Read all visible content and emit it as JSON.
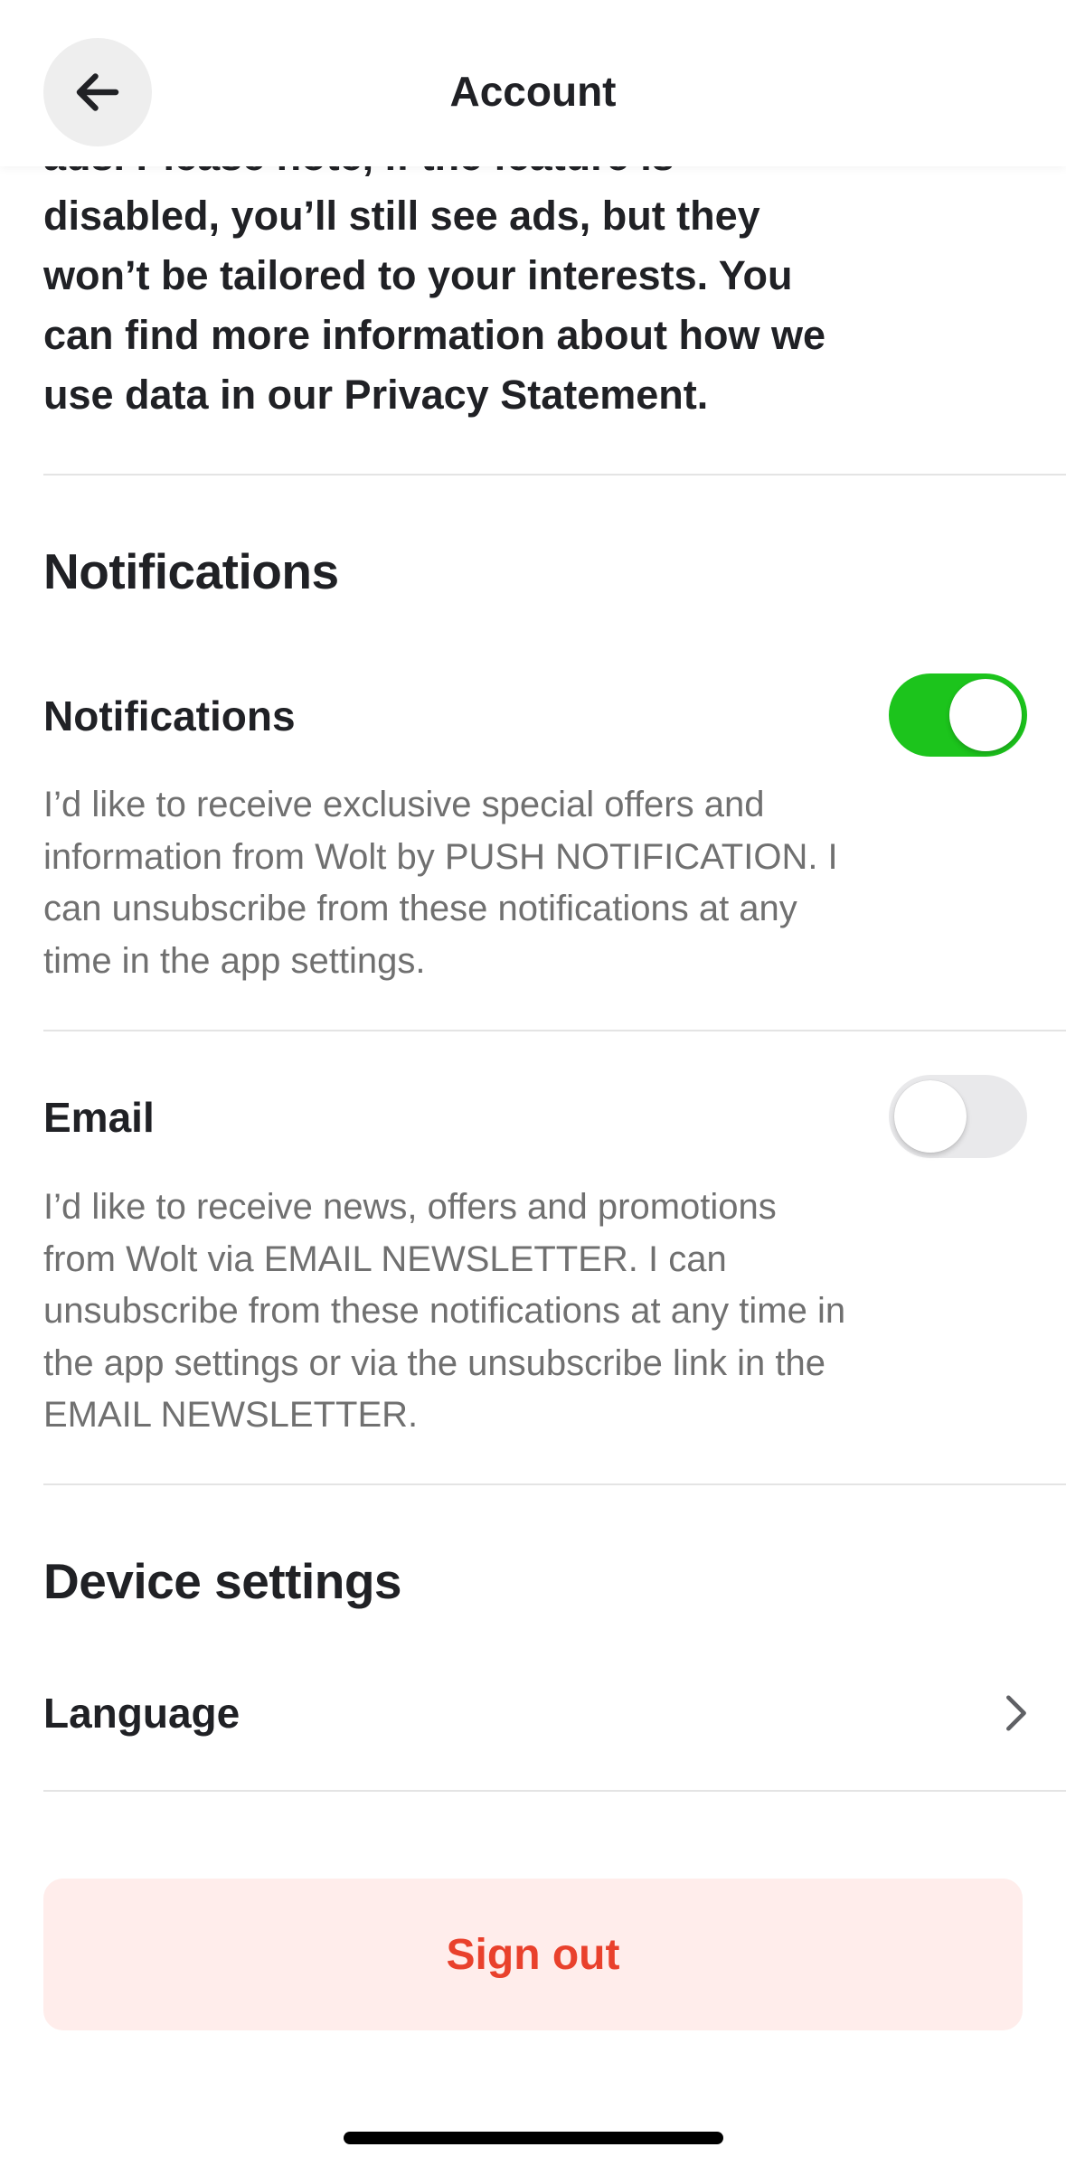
{
  "header": {
    "title": "Account",
    "back_icon": "arrow-left-icon"
  },
  "privacy": {
    "text": "ads. Please note, if the feature is disabled, you’ll still see ads, but they won’t be tailored to your interests. You can find more information about how we use data in our Privacy Statement."
  },
  "notifications_section": {
    "title": "Notifications",
    "push": {
      "title": "Notifications",
      "description": "I’d like to receive exclusive special offers and information from Wolt by PUSH NOTIFICATION. I can unsubscribe from these notifications at any time in the app settings.",
      "enabled": true
    },
    "email": {
      "title": "Email",
      "description": "I’d like to receive news, offers and promotions from Wolt via EMAIL NEWSLETTER. I can unsubscribe from these notifications at any time in the app settings or via the unsubscribe link in the EMAIL NEWSLETTER.",
      "enabled": false
    }
  },
  "device_section": {
    "title": "Device settings",
    "language_label": "Language",
    "chevron_icon": "chevron-right-icon"
  },
  "signout": {
    "label": "Sign out"
  },
  "colors": {
    "toggle_on": "#1cc41c",
    "toggle_off": "#e9e9eb",
    "signout_bg": "#ffedeb",
    "signout_text": "#e9412c",
    "primary_text": "#202125",
    "secondary_text": "#707070"
  }
}
